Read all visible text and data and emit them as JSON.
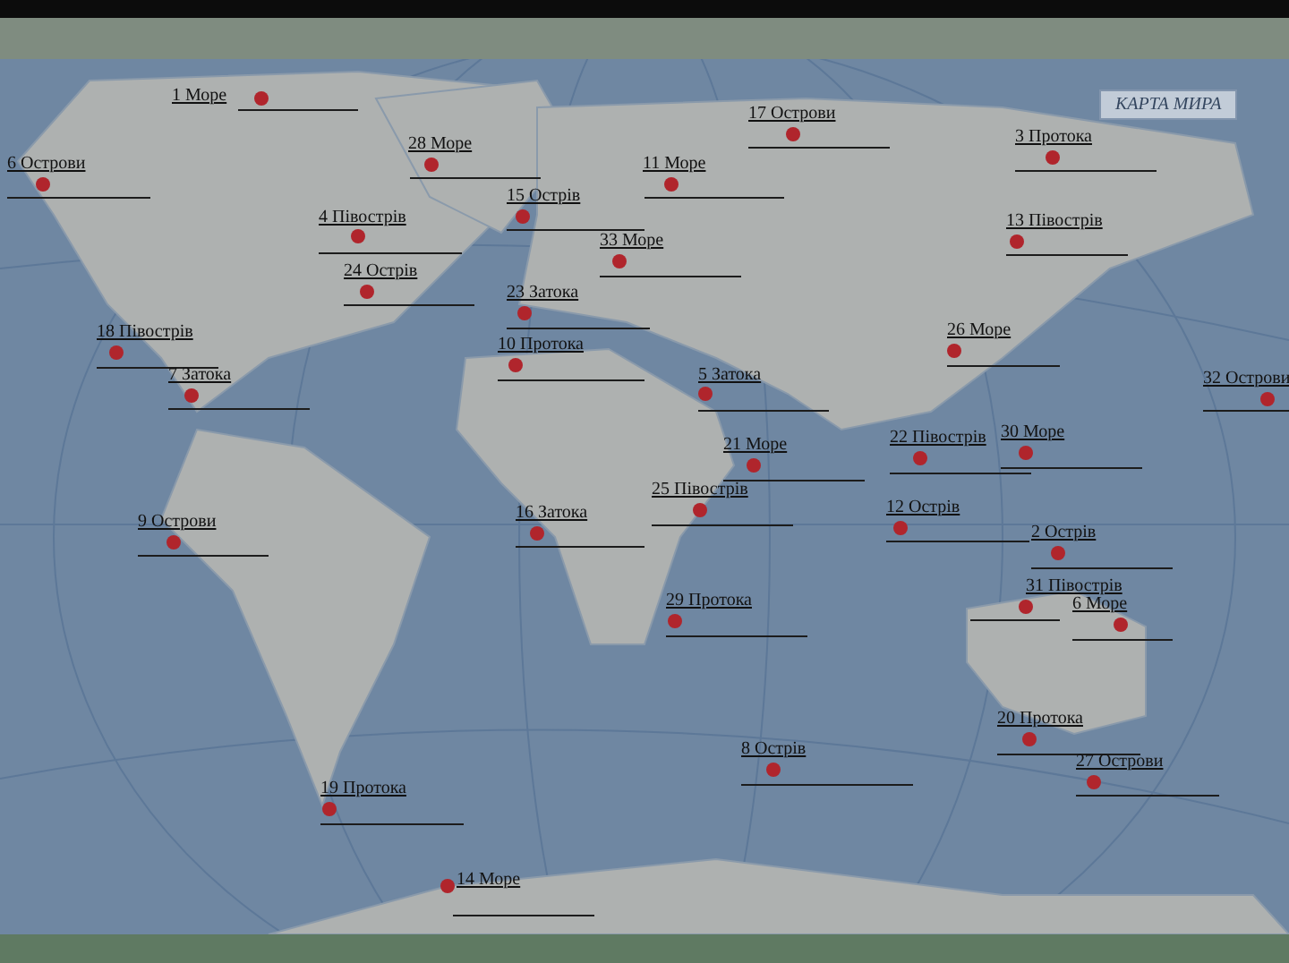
{
  "map": {
    "title": "КАРТА МИРА"
  },
  "labels": [
    "1 Море",
    "28 Море",
    "6 Острови",
    "15 Острів",
    "11 Море",
    "17 Острови",
    "3 Протока",
    "4 Півострів",
    "33 Море",
    "13 Півострів",
    "24 Острів",
    "23 Затока",
    "18 Півострів",
    "10 Протока",
    "26 Море",
    "7 Затока",
    "5 Затока",
    "32 Острови",
    "21 Море",
    "22 Півострів",
    "30 Море",
    "25 Півострів",
    "9 Острови",
    "16 Затока",
    "12 Острів",
    "2 Острів",
    "31 Півострів",
    "6 Море",
    "29 Протока",
    "20 Протока",
    "8 Острів",
    "27 Острови",
    "19 Протока",
    "14 Море"
  ]
}
